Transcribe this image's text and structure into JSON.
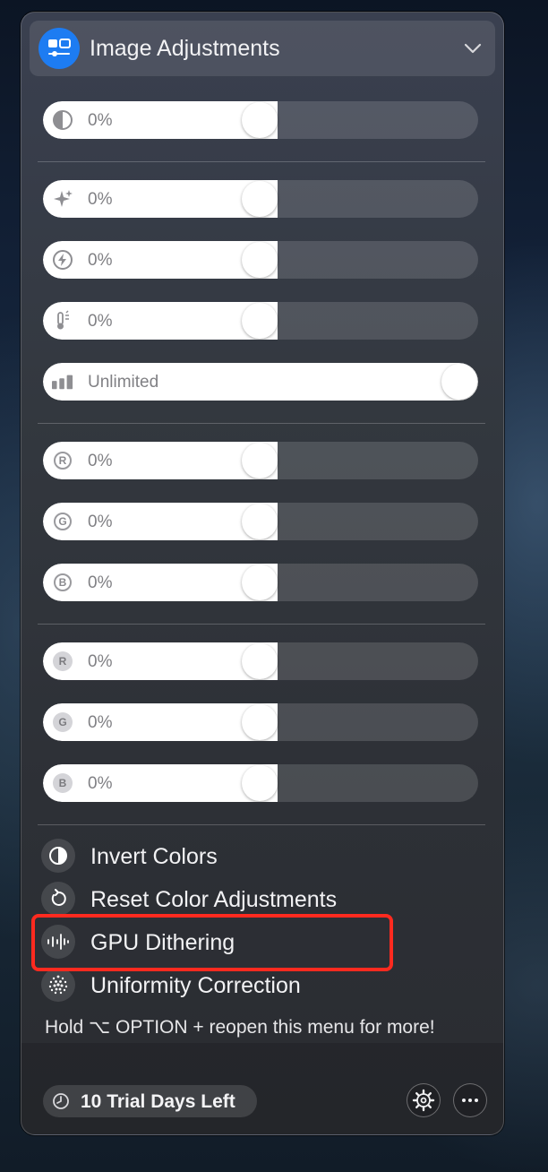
{
  "header": {
    "title": "Image Adjustments",
    "app_icon": "display-adjust-icon",
    "chevron_icon": "chevron-down-icon"
  },
  "sliders": [
    {
      "name": "contrast",
      "icon": "contrast-icon",
      "value": "0%",
      "level": 0.5
    },
    {
      "name": "sharpness",
      "icon": "sparkle-icon",
      "value": "0%",
      "level": 0.5
    },
    {
      "name": "gamma",
      "icon": "bolt-icon",
      "value": "0%",
      "level": 0.5
    },
    {
      "name": "temperature",
      "icon": "thermometer-icon",
      "value": "0%",
      "level": 0.5
    },
    {
      "name": "limit",
      "icon": "bars-icon",
      "value": "Unlimited",
      "level": 1.0
    },
    {
      "name": "red-gain",
      "icon": "r-ring-icon",
      "letter": "R",
      "value": "0%",
      "level": 0.5
    },
    {
      "name": "green-gain",
      "icon": "g-ring-icon",
      "letter": "G",
      "value": "0%",
      "level": 0.5
    },
    {
      "name": "blue-gain",
      "icon": "b-ring-icon",
      "letter": "B",
      "value": "0%",
      "level": 0.5
    },
    {
      "name": "red-offset",
      "icon": "r-fill-icon",
      "letter": "R",
      "value": "0%",
      "level": 0.5
    },
    {
      "name": "green-offset",
      "icon": "g-fill-icon",
      "letter": "G",
      "value": "0%",
      "level": 0.5
    },
    {
      "name": "blue-offset",
      "icon": "b-fill-icon",
      "letter": "B",
      "value": "0%",
      "level": 0.5
    }
  ],
  "menu": [
    {
      "label": "Invert Colors",
      "icon": "invert-icon"
    },
    {
      "label": "Reset Color Adjustments",
      "icon": "reset-icon"
    },
    {
      "label": "GPU Dithering",
      "icon": "dither-icon"
    },
    {
      "label": "Uniformity Correction",
      "icon": "dots-grid-icon"
    }
  ],
  "hint": "Hold ⌥ OPTION + reopen this menu for more!",
  "footer": {
    "trial_label": "10 Trial Days Left",
    "trial_icon": "clock-icon",
    "settings_icon": "gear-icon",
    "more_icon": "ellipsis-icon"
  },
  "colors": {
    "accent": "#1d7cf2",
    "highlight": "#ff2a1f"
  }
}
